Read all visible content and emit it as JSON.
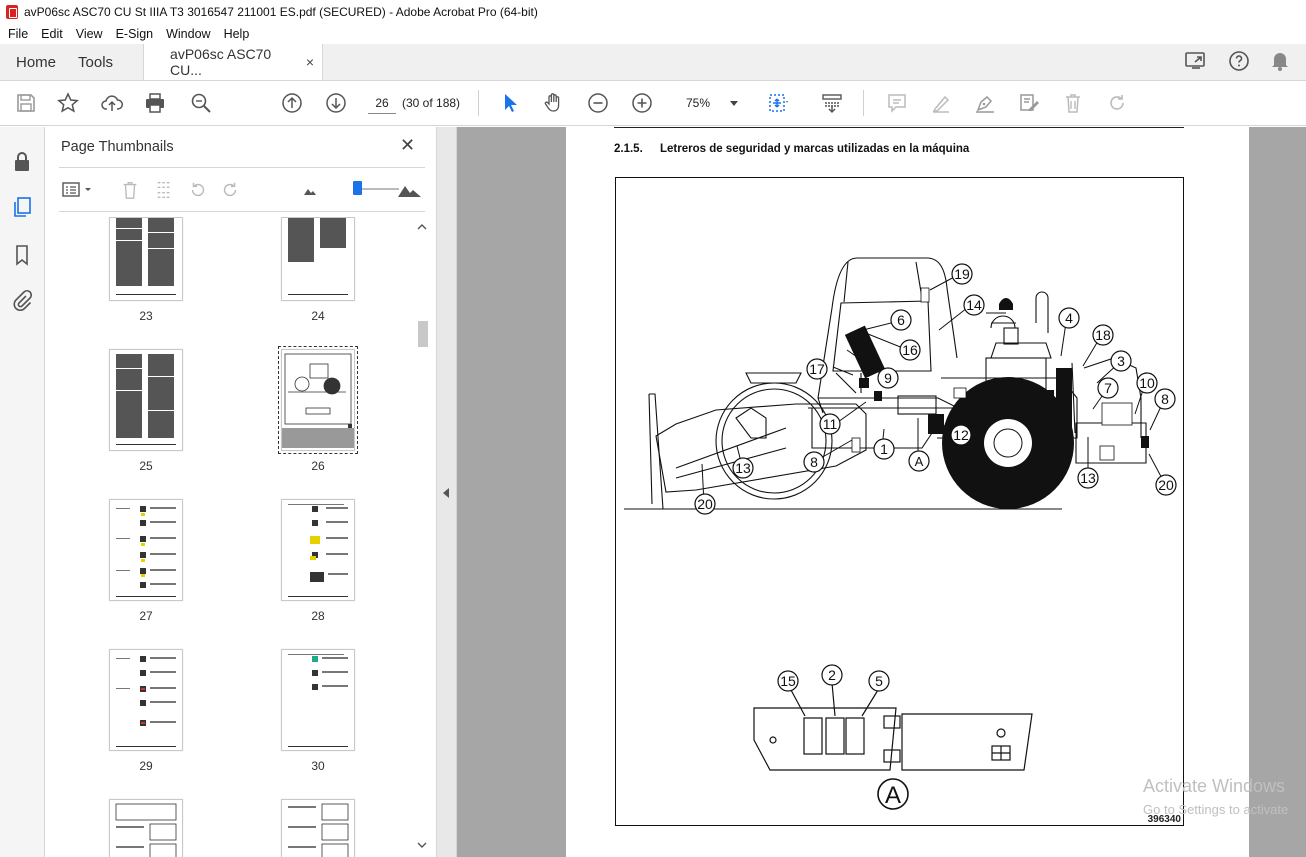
{
  "window": {
    "title": "avP06sc ASC70 CU St IIIA T3 3016547 211001 ES.pdf (SECURED) - Adobe Acrobat Pro (64-bit)"
  },
  "menu": [
    "File",
    "Edit",
    "View",
    "E-Sign",
    "Window",
    "Help"
  ],
  "tabs": {
    "home": "Home",
    "tools": "Tools",
    "document": "avP06sc ASC70 CU...",
    "close": "×"
  },
  "toolbar": {
    "page_number": "26",
    "page_count": "(30 of 188)",
    "zoom": "75%"
  },
  "panel": {
    "title": "Page Thumbnails",
    "close": "✕",
    "thumbnails": [
      {
        "label": "23"
      },
      {
        "label": "24"
      },
      {
        "label": "25"
      },
      {
        "label": "26"
      },
      {
        "label": "27"
      },
      {
        "label": "28"
      },
      {
        "label": "29"
      },
      {
        "label": "30"
      },
      {
        "label": ""
      },
      {
        "label": ""
      }
    ]
  },
  "page": {
    "section_number": "2.1.5.",
    "section_title": "Letreros de seguridad y marcas utilizadas en la máquina",
    "figure_code": "396340",
    "callouts": [
      "19",
      "14",
      "6",
      "16",
      "9",
      "17",
      "11",
      "1",
      "12",
      "8",
      "13",
      "20",
      "4",
      "18",
      "3",
      "7",
      "10",
      "8",
      "13",
      "20",
      "15",
      "2",
      "5"
    ],
    "detail_label": "A"
  },
  "watermark": {
    "title": "Activate Windows",
    "subtitle": "Go to Settings to activate"
  },
  "colors": {
    "accent": "#1a73e8",
    "acrobat_red": "#d92323",
    "doc_bg": "#a6a6a6"
  }
}
